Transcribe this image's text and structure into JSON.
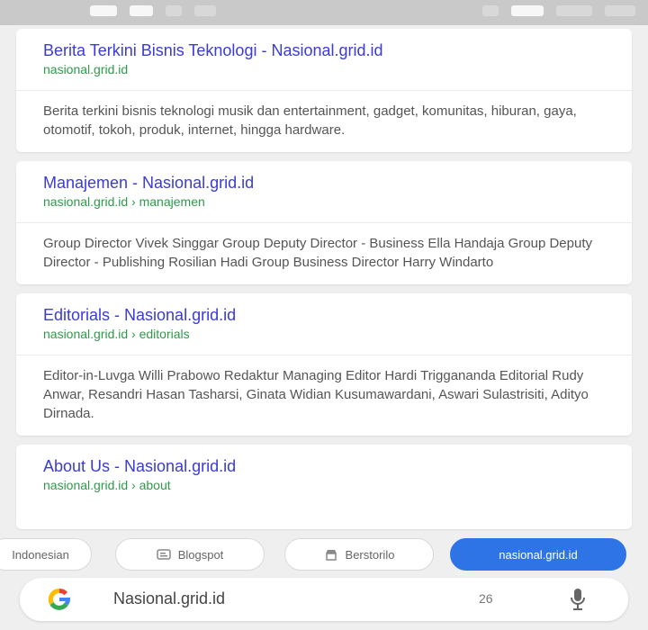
{
  "status_bar": {},
  "results": [
    {
      "title": "Berita Terkini Bisnis Teknologi - Nasional.grid.id",
      "url": "nasional.grid.id",
      "snippet": "Berita terkini bisnis teknologi musik dan entertainment, gadget, komunitas, hiburan, gaya, otomotif, tokoh, produk, internet, hingga hardware."
    },
    {
      "title": "Manajemen - Nasional.grid.id",
      "url": "nasional.grid.id › manajemen",
      "snippet": "Group Director Vivek Singgar Group Deputy Director - Business Ella Handaja Group Deputy Director - Publishing Rosilian Hadi Group Business Director Harry Windarto"
    },
    {
      "title": "Editorials - Nasional.grid.id",
      "url": "nasional.grid.id › editorials",
      "snippet": "Editor-in-Luvga Willi Prabowo Redaktur Managing Editor Hardi Triggananda Editorial Rudy Anwar, Resandri Hasan Tasharsi, Ginata Widian Kusumawardani, Aswari Sulastrisiti, Adityo Dirnada."
    },
    {
      "title": "About Us - Nasional.grid.id",
      "url": "nasional.grid.id › about",
      "snippet": ""
    }
  ],
  "chips": [
    {
      "label": "Indonesian",
      "icon": ""
    },
    {
      "label": "Blogspot",
      "icon": "blog-icon"
    },
    {
      "label": "Berstorilo",
      "icon": "shop-icon"
    },
    {
      "label": "nasional.grid.id",
      "icon": ""
    }
  ],
  "search": {
    "query": "Nasional.grid.id",
    "count": "26",
    "logo_icon": "google-logo-icon",
    "mic_icon": "mic-icon"
  },
  "colors": {
    "title_link": "#3b3bd6",
    "url_green": "#2e9a4a",
    "primary_chip": "#2f74e6"
  }
}
